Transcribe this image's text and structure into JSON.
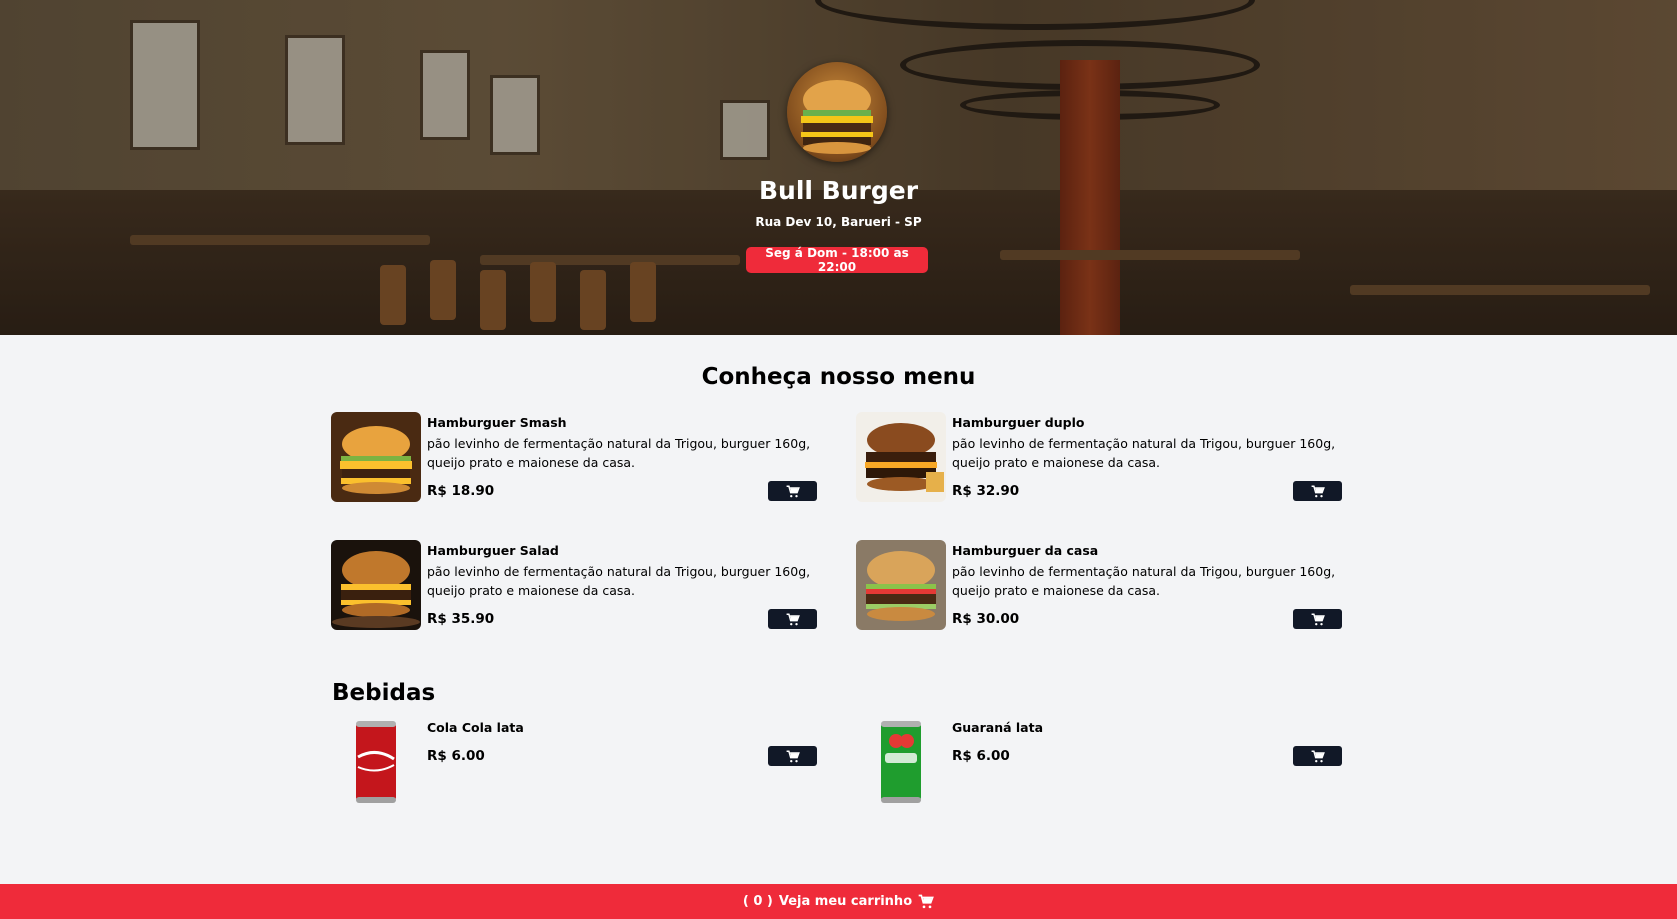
{
  "restaurant": {
    "name": "Bull Burger",
    "address": "Rua Dev 10, Barueri - SP",
    "hours": "Seg á Dom - 18:00 as 22:00"
  },
  "menu": {
    "title": "Conheça nosso menu",
    "items": [
      {
        "name": "Hamburguer Smash",
        "desc": "pão levinho de fermentação natural da Trigou, burguer 160g, queijo prato e maionese da casa.",
        "price": "R$ 18.90"
      },
      {
        "name": "Hamburguer duplo",
        "desc": "pão levinho de fermentação natural da Trigou, burguer 160g, queijo prato e maionese da casa.",
        "price": "R$ 32.90"
      },
      {
        "name": "Hamburguer Salad",
        "desc": "pão levinho de fermentação natural da Trigou, burguer 160g, queijo prato e maionese da casa.",
        "price": "R$ 35.90"
      },
      {
        "name": "Hamburguer da casa",
        "desc": "pão levinho de fermentação natural da Trigou, burguer 160g, queijo prato e maionese da casa.",
        "price": "R$ 30.00"
      }
    ]
  },
  "drinks": {
    "title": "Bebidas",
    "items": [
      {
        "name": "Cola Cola lata",
        "price": "R$ 6.00"
      },
      {
        "name": "Guaraná lata",
        "price": "R$ 6.00"
      }
    ]
  },
  "footer": {
    "count": "( 0 )",
    "label": "Veja meu carrinho",
    "icon": "cart-icon"
  },
  "colors": {
    "accent": "#ef2b3a",
    "button": "#111827",
    "background": "#f3f4f6"
  }
}
